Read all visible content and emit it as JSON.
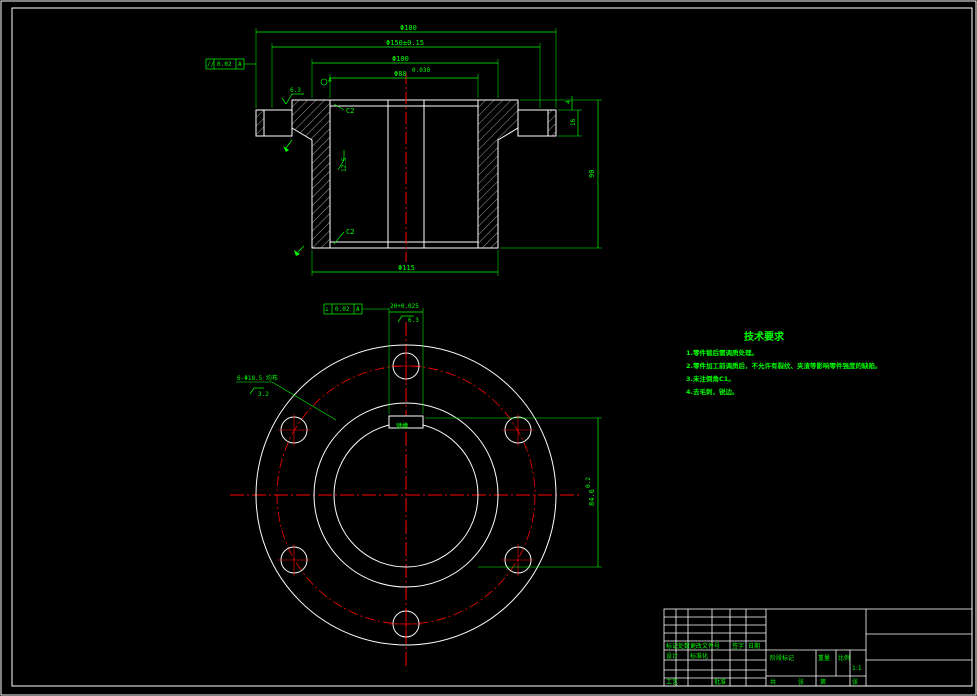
{
  "colors": {
    "background": "#000000",
    "outline": "#ffffff",
    "dimension": "#00ff00",
    "centerline": "#ff0000",
    "hatch": "#c8c8c8"
  },
  "section_view": {
    "dims": {
      "overall_dia": "Φ180",
      "bolt_circle": "Φ150±0.15",
      "inner_dia": "Φ100",
      "bore": "Φ80",
      "bore_tol": "0.030",
      "bottom_dia": "Φ115",
      "height": "90",
      "flange_thk": "16",
      "flange_t2": "4"
    },
    "chamfer_top": "C2",
    "chamfer_bottom": "C2",
    "roughness_top": "6.3",
    "roughness_side": "12.5",
    "tol_frame": [
      "//",
      "0.02",
      "A"
    ],
    "datum_label": "A"
  },
  "plan_view": {
    "tol_frame": [
      "⊥",
      "0.02",
      "A"
    ],
    "keyway_width": "20+0.025",
    "keyway_depth": "84.6",
    "keyway_tol": "0.2",
    "roughness": "6.3",
    "holes_callout": "6-Φ18.5 均布",
    "holes_roughness": "3.2",
    "keyway_label": "键槽"
  },
  "notes": {
    "title": "技术要求",
    "items": [
      "1.零件锻后需调质处理。",
      "2.零件加工前调质后，不允许有裂纹、夹渣等影响零件强度的缺陷。",
      "3.未注倒角C1。",
      "4.去毛刺，锐边。"
    ]
  },
  "title_block": {
    "row_a": [
      "标记",
      "处数",
      "更改文件号",
      "签字",
      "日期"
    ],
    "row_b": [
      "设计",
      "标准化",
      "阶段标记",
      "重量",
      "比例"
    ],
    "row_c": [
      "工艺",
      "批准",
      "共",
      "张",
      "第",
      "张"
    ],
    "scale": "1:1"
  }
}
